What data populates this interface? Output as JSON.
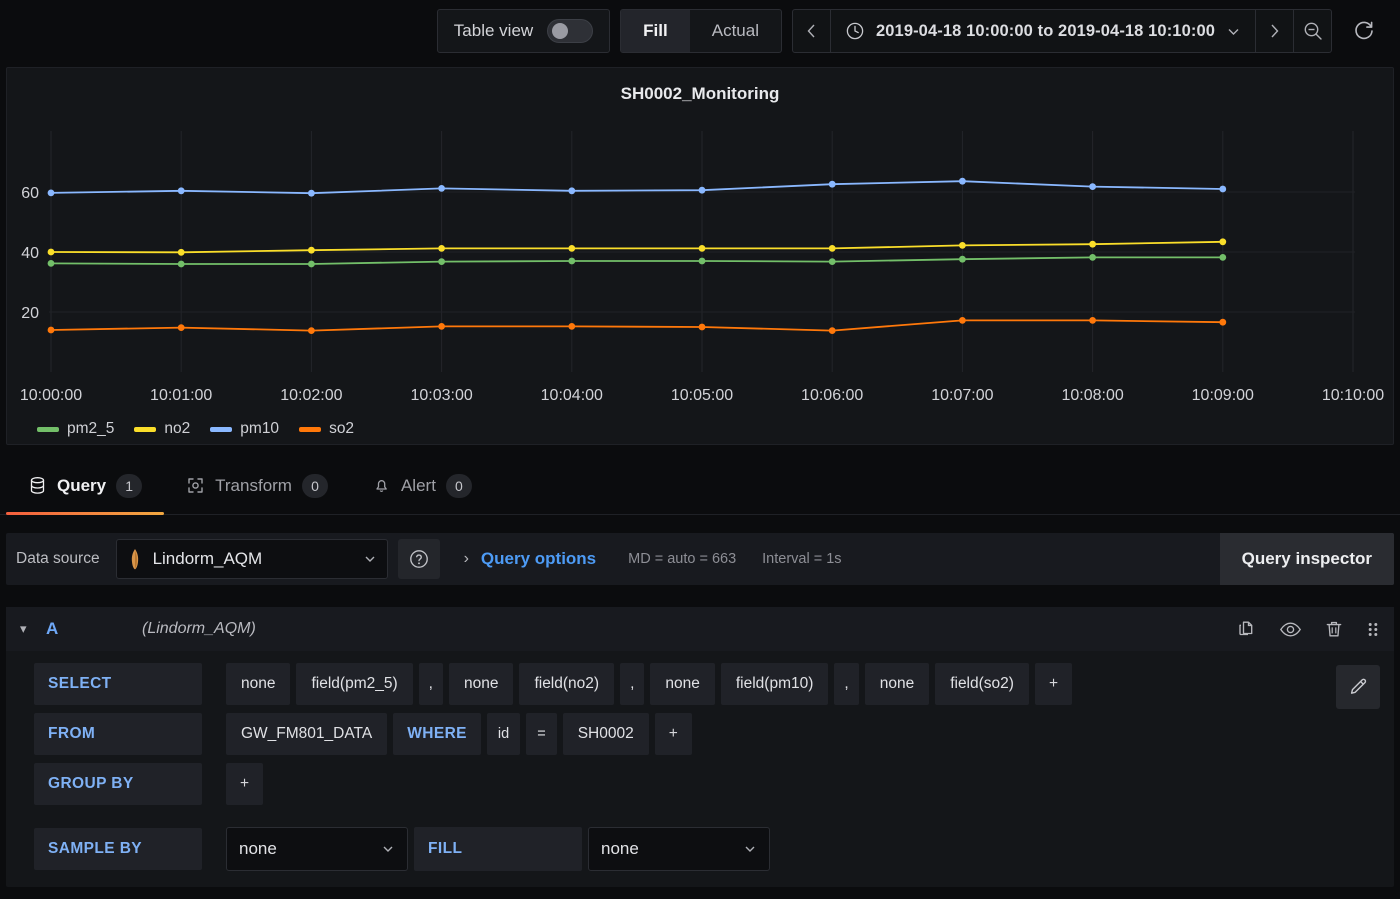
{
  "toolbar": {
    "table_view_label": "Table view",
    "table_view_on": false,
    "segmented": {
      "options": [
        "Fill",
        "Actual"
      ],
      "selected": "Fill"
    },
    "time_range": "2019-04-18 10:00:00 to 2019-04-18 10:10:00",
    "prev_icon": "chevron-left-icon",
    "next_icon": "chevron-right-icon",
    "clock_icon": "clock-icon",
    "zoom_out_icon": "zoom-out-icon",
    "refresh_icon": "refresh-icon"
  },
  "panel": {
    "title": "SH0002_Monitoring"
  },
  "chart_data": {
    "type": "line",
    "title": "SH0002_Monitoring",
    "xlabel": "",
    "ylabel": "",
    "ylim": [
      0,
      72
    ],
    "yticks": [
      20,
      40,
      60
    ],
    "grid": true,
    "legend_position": "bottom-left",
    "x": [
      "10:00:00",
      "10:01:00",
      "10:02:00",
      "10:03:00",
      "10:04:00",
      "10:05:00",
      "10:06:00",
      "10:07:00",
      "10:08:00",
      "10:09:00"
    ],
    "xticks": [
      "10:00:00",
      "10:01:00",
      "10:02:00",
      "10:03:00",
      "10:04:00",
      "10:05:00",
      "10:06:00",
      "10:07:00",
      "10:08:00",
      "10:09:00",
      "10:10:00"
    ],
    "series": [
      {
        "name": "pm2_5",
        "color": "#73bf69",
        "values": [
          36.2,
          36.0,
          36.0,
          36.8,
          37.0,
          37.0,
          36.8,
          37.6,
          38.2,
          38.2
        ]
      },
      {
        "name": "no2",
        "color": "#fade2a",
        "values": [
          40.0,
          39.9,
          40.6,
          41.2,
          41.2,
          41.2,
          41.2,
          42.2,
          42.6,
          43.4
        ]
      },
      {
        "name": "pm10",
        "color": "#8ab8ff",
        "values": [
          59.7,
          60.4,
          59.6,
          61.2,
          60.4,
          60.6,
          62.6,
          63.6,
          61.8,
          61.0
        ]
      },
      {
        "name": "so2",
        "color": "#ff780a",
        "values": [
          14.0,
          14.8,
          13.8,
          15.2,
          15.2,
          15.0,
          13.8,
          17.2,
          17.2,
          16.6
        ]
      }
    ]
  },
  "tabs": [
    {
      "label": "Query",
      "badge": "1",
      "icon": "database-icon",
      "active": true
    },
    {
      "label": "Transform",
      "badge": "0",
      "icon": "transform-icon",
      "active": false
    },
    {
      "label": "Alert",
      "badge": "0",
      "icon": "bell-icon",
      "active": false
    }
  ],
  "datasource_row": {
    "label": "Data source",
    "selected": "Lindorm_AQM",
    "ds_icon": "lindorm-logo-icon",
    "help_icon": "question-circle-icon",
    "query_options_label": "Query options",
    "meta_md": "MD = auto = 663",
    "meta_interval": "Interval = 1s",
    "query_inspector_label": "Query inspector"
  },
  "query": {
    "ref_id": "A",
    "datasource_note": "(Lindorm_AQM)",
    "actions": [
      {
        "name": "duplicate-query-icon"
      },
      {
        "name": "hide-query-icon"
      },
      {
        "name": "delete-query-icon"
      },
      {
        "name": "drag-handle-icon"
      }
    ],
    "edit_icon": "pencil-icon",
    "select_row": {
      "key": "SELECT",
      "items": [
        {
          "agg": "none",
          "field": "field(pm2_5)"
        },
        {
          "agg": "none",
          "field": "field(no2)"
        },
        {
          "agg": "none",
          "field": "field(pm10)"
        },
        {
          "agg": "none",
          "field": "field(so2)"
        }
      ],
      "separator": ",",
      "add": "+"
    },
    "from_row": {
      "key": "FROM",
      "table": "GW_FM801_DATA",
      "where_key": "WHERE",
      "condition": {
        "field": "id",
        "operator": "=",
        "value": "SH0002"
      },
      "add": "+"
    },
    "group_by_row": {
      "key": "GROUP BY",
      "add": "+"
    },
    "sample_by_row": {
      "key": "SAMPLE BY",
      "sample_value": "none",
      "fill_key": "FILL",
      "fill_value": "none"
    }
  }
}
